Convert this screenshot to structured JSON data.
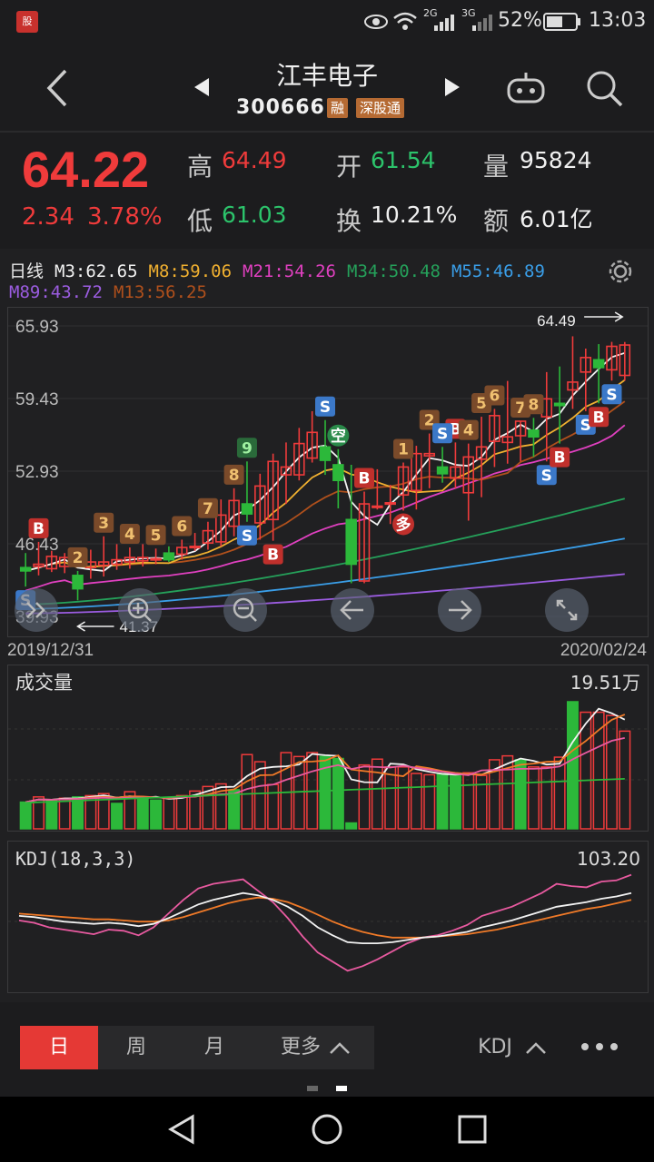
{
  "status": {
    "app_icon_text": "股",
    "battery": "52%",
    "time": "13:03",
    "sig1": "2G",
    "sig2": "3G"
  },
  "header": {
    "name": "江丰电子",
    "code": "300666",
    "tags": [
      "融",
      "深股通"
    ]
  },
  "quote": {
    "price": "64.22",
    "change": "2.34",
    "change_pct": "3.78%",
    "high_label": "高",
    "high": "64.49",
    "open_label": "开",
    "open": "61.54",
    "vol_label": "量",
    "vol": "95824",
    "low_label": "低",
    "low": "61.03",
    "turnover_label": "换",
    "turnover": "10.21%",
    "amount_label": "额",
    "amount": "6.01亿"
  },
  "ma_legend": [
    {
      "text": "日线",
      "color": "#e8e8e8"
    },
    {
      "text": "M3:62.65",
      "color": "#f2f2f2"
    },
    {
      "text": "M8:59.06",
      "color": "#f0b030"
    },
    {
      "text": "M21:54.26",
      "color": "#e040c0"
    },
    {
      "text": "M34:50.48",
      "color": "#25a05a"
    },
    {
      "text": "M55:46.89",
      "color": "#3a9ee8"
    },
    {
      "text": "M89:43.72",
      "color": "#9b5ce0"
    },
    {
      "text": "M13:56.25",
      "color": "#b0501c"
    }
  ],
  "chart_data": [
    {
      "type": "candlestick",
      "title": "日线",
      "y_ticks": [
        "65.93",
        "59.43",
        "52.93",
        "46.43",
        "39.93"
      ],
      "ylim": [
        39.93,
        65.93
      ],
      "high_marker": "64.49",
      "low_marker": "41.37",
      "date_start": "2019/12/31",
      "date_end": "2020/02/24",
      "candles": [
        [
          44.3,
          44.0,
          45.6,
          42.6
        ],
        [
          44.4,
          44.6,
          46.6,
          43.6
        ],
        [
          44.2,
          45.3,
          45.8,
          43.9
        ],
        [
          44.4,
          45.2,
          45.6,
          43.8
        ],
        [
          43.6,
          42.4,
          44.0,
          41.37
        ],
        [
          44.3,
          44.8,
          45.9,
          43.3
        ],
        [
          44.5,
          44.8,
          47.1,
          43.5
        ],
        [
          44.6,
          45.0,
          46.4,
          44.1
        ],
        [
          44.8,
          45.2,
          46.1,
          44.2
        ],
        [
          44.9,
          45.2,
          46.4,
          44.4
        ],
        [
          45.0,
          45.1,
          46.0,
          44.6
        ],
        [
          45.6,
          45.0,
          46.2,
          44.8
        ],
        [
          45.5,
          46.1,
          46.8,
          45.0
        ],
        [
          46.2,
          46.2,
          47.4,
          45.8
        ],
        [
          46.5,
          47.6,
          48.4,
          45.9
        ],
        [
          46.6,
          49.0,
          50.4,
          46.2
        ],
        [
          48.0,
          50.3,
          51.4,
          47.1
        ],
        [
          50.0,
          49.1,
          53.8,
          48.4
        ],
        [
          48.3,
          51.6,
          52.7,
          46.8
        ],
        [
          48.6,
          53.8,
          54.5,
          46.7
        ],
        [
          52.6,
          53.3,
          55.5,
          50.0
        ],
        [
          52.6,
          55.4,
          56.8,
          52.1
        ],
        [
          54.1,
          56.4,
          58.3,
          53.7
        ],
        [
          55.1,
          53.9,
          57.5,
          52.6
        ],
        [
          53.5,
          52.1,
          54.9,
          49.6
        ],
        [
          48.6,
          44.6,
          53.5,
          42.9
        ],
        [
          43.1,
          50.0,
          51.1,
          42.9
        ],
        [
          49.7,
          49.8,
          53.1,
          49.5
        ],
        [
          50.0,
          50.1,
          51.7,
          48.2
        ],
        [
          50.8,
          53.3,
          53.7,
          49.4
        ],
        [
          51.2,
          54.5,
          55.2,
          49.5
        ],
        [
          54.3,
          54.5,
          56.3,
          51.4
        ],
        [
          53.3,
          52.7,
          55.1,
          51.9
        ],
        [
          52.3,
          53.3,
          55.5,
          51.4
        ],
        [
          51.0,
          54.2,
          55.4,
          48.5
        ],
        [
          54.0,
          55.1,
          57.8,
          50.6
        ],
        [
          55.6,
          57.9,
          58.5,
          53.3
        ],
        [
          55.5,
          56.0,
          61.0,
          53.6
        ],
        [
          56.1,
          57.4,
          57.4,
          53.8
        ],
        [
          56.6,
          56.0,
          57.7,
          54.2
        ],
        [
          57.8,
          59.4,
          61.8,
          53.8
        ],
        [
          59.0,
          58.8,
          62.3,
          55.4
        ],
        [
          60.2,
          60.9,
          65.0,
          58.5
        ],
        [
          61.8,
          63.1,
          63.9,
          58.3
        ],
        [
          62.9,
          62.2,
          64.3,
          59.0
        ],
        [
          62.0,
          64.1,
          64.5,
          61.03
        ],
        [
          61.5,
          64.22,
          64.49,
          61.03
        ]
      ],
      "bs_markers": [
        "S",
        "B",
        "2",
        "3",
        "4",
        "5",
        "6",
        "7",
        "8",
        "9",
        "S",
        "B",
        "S",
        "B",
        "空",
        "多",
        "B",
        "1",
        "2",
        "S",
        "4",
        "5",
        "6",
        "7",
        "8",
        "S",
        "B",
        "S",
        "B",
        "S"
      ]
    },
    {
      "type": "bar",
      "title": "成交量",
      "max_label": "19.51万",
      "values": [
        4.1,
        4.9,
        4.4,
        4.7,
        4.9,
        5.1,
        5.4,
        3.9,
        5.7,
        4.7,
        4.4,
        4.7,
        5.1,
        5.8,
        6.5,
        6.9,
        6.0,
        11.4,
        10.3,
        6.8,
        11.7,
        11.1,
        11.7,
        11.1,
        10.8,
        0.9,
        9.8,
        10.7,
        9.5,
        9.5,
        8.5,
        8.3,
        8.5,
        8.1,
        8.6,
        8.2,
        10.6,
        11.2,
        10.6,
        9.5,
        9.5,
        11.0,
        19.51,
        17.9,
        17.9,
        17.4,
        15.0
      ],
      "up_down": [
        "dn",
        "up",
        "dn",
        "up",
        "dn",
        "up",
        "up",
        "dn",
        "up",
        "dn",
        "dn",
        "up",
        "up",
        "up",
        "up",
        "up",
        "dn",
        "up",
        "up",
        "up",
        "up",
        "up",
        "up",
        "dn",
        "dn",
        "dn",
        "up",
        "up",
        "up",
        "up",
        "up",
        "up",
        "dn",
        "dn",
        "up",
        "up",
        "up",
        "up",
        "dn",
        "up",
        "up",
        "up",
        "dn",
        "up",
        "up",
        "up",
        "up"
      ]
    },
    {
      "type": "line",
      "title": "KDJ(18,3,3)",
      "max_label": "103.20",
      "series": [
        {
          "name": "K",
          "color": "#f2f2f2",
          "values": [
            62,
            61,
            59,
            57,
            56,
            55,
            56,
            55,
            53,
            55,
            60,
            66,
            72,
            76,
            79,
            82,
            80,
            76,
            70,
            62,
            52,
            45,
            39,
            38,
            38,
            39,
            41,
            43,
            44,
            46,
            48,
            52,
            55,
            58,
            62,
            66,
            70,
            72,
            74,
            77,
            79,
            82
          ]
        },
        {
          "name": "D",
          "color": "#f07a28",
          "values": [
            64,
            63,
            62,
            61,
            60,
            59,
            59,
            58,
            57,
            57,
            58,
            61,
            65,
            69,
            73,
            76,
            78,
            77,
            74,
            69,
            63,
            57,
            52,
            48,
            45,
            43,
            43,
            43,
            44,
            45,
            46,
            48,
            50,
            53,
            56,
            59,
            62,
            65,
            68,
            70,
            73,
            76
          ]
        },
        {
          "name": "J",
          "color": "#e85aa0",
          "values": [
            58,
            56,
            52,
            50,
            48,
            46,
            50,
            49,
            45,
            52,
            64,
            76,
            86,
            90,
            92,
            94,
            84,
            74,
            60,
            44,
            30,
            22,
            14,
            18,
            24,
            31,
            38,
            43,
            45,
            49,
            54,
            62,
            66,
            70,
            76,
            82,
            90,
            88,
            87,
            92,
            93,
            98
          ]
        }
      ]
    }
  ],
  "tabs": {
    "day": "日",
    "week": "周",
    "month": "月",
    "more": "更多",
    "indicator": "KDJ"
  },
  "colors": {
    "up": "#ef3b3b",
    "down": "#2cb83a",
    "bg": "#202022"
  },
  "icons": [
    "back-icon",
    "prev-icon",
    "next-icon",
    "robot-icon",
    "search-icon",
    "settings-icon",
    "zoom-in-icon",
    "zoom-out-icon",
    "left-icon",
    "right-icon",
    "fullscreen-icon",
    "more-icon"
  ]
}
